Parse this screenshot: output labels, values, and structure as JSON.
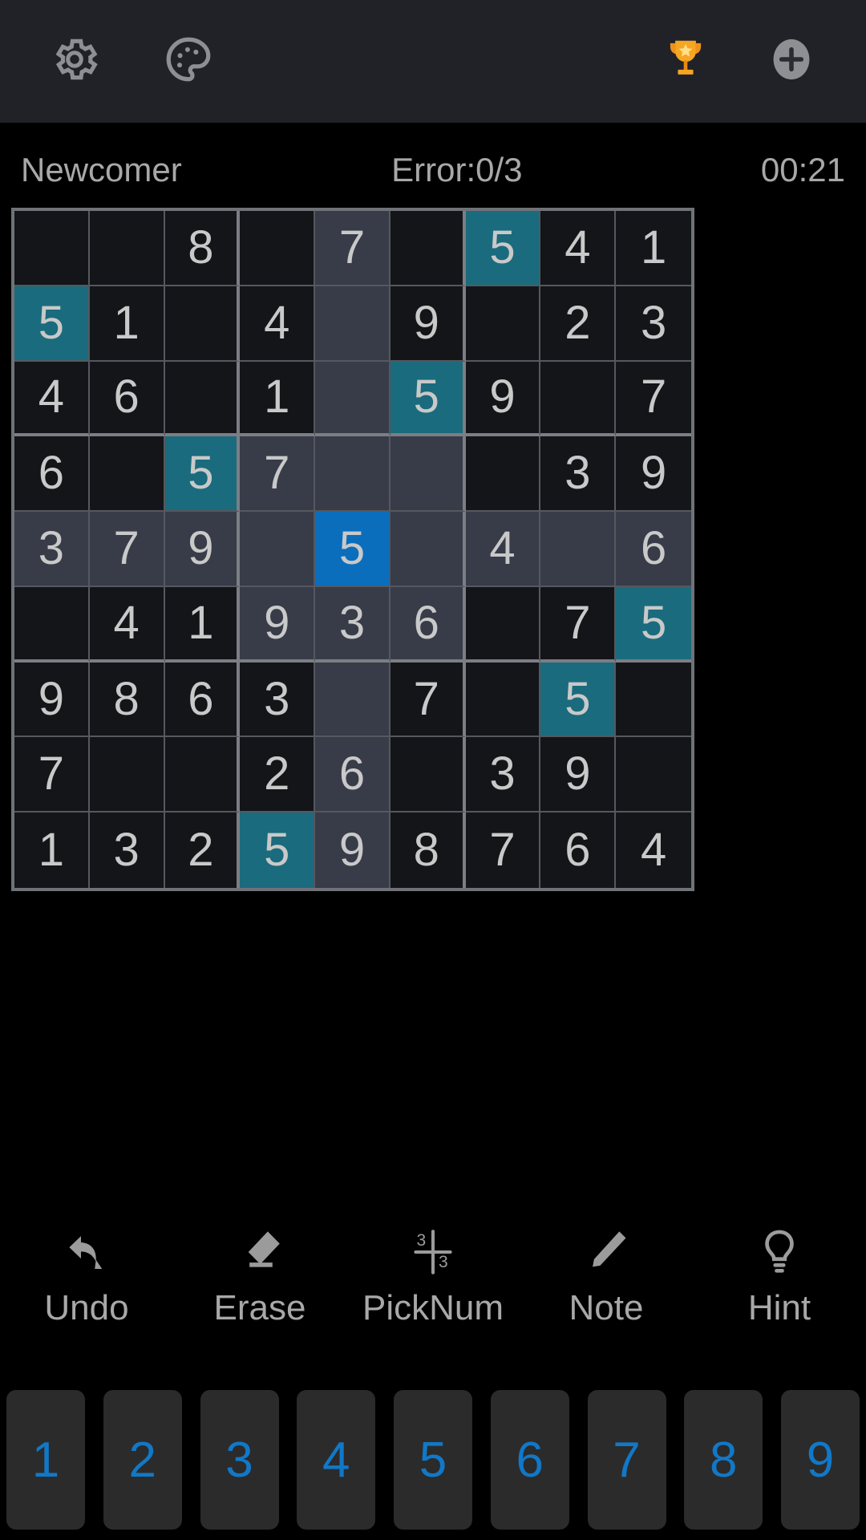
{
  "appbar": {
    "settings_icon": "gear-icon",
    "theme_icon": "palette-icon",
    "trophy_icon": "trophy-icon",
    "add_icon": "plus-circle-icon"
  },
  "status": {
    "difficulty": "Newcomer",
    "errors": "Error:0/3",
    "timer": "00:21"
  },
  "board": {
    "selected": {
      "row": 4,
      "col": 4
    },
    "highlight_value": "5",
    "colors": {
      "cell_bg": "#141519",
      "peer_bg": "#383c49",
      "same_value_bg": "#1a6b7d",
      "selected_bg": "#0a6ebd",
      "digit": "#c9c9c9",
      "grid_line": "#55585e",
      "box_line": "#7b7e84"
    },
    "rows": [
      [
        "",
        "",
        "8",
        "",
        "7",
        "",
        "5",
        "4",
        "1"
      ],
      [
        "5",
        "1",
        "",
        "4",
        "",
        "9",
        "",
        "2",
        "3"
      ],
      [
        "4",
        "6",
        "",
        "1",
        "",
        "5",
        "9",
        "",
        "7"
      ],
      [
        "6",
        "",
        "5",
        "7",
        "",
        "",
        "",
        "3",
        "9"
      ],
      [
        "3",
        "7",
        "9",
        "",
        "5",
        "",
        "4",
        "",
        "6"
      ],
      [
        "",
        "4",
        "1",
        "9",
        "3",
        "6",
        "",
        "7",
        "5"
      ],
      [
        "9",
        "8",
        "6",
        "3",
        "",
        "7",
        "",
        "5",
        ""
      ],
      [
        "7",
        "",
        "",
        "2",
        "6",
        "",
        "3",
        "9",
        ""
      ],
      [
        "1",
        "3",
        "2",
        "5",
        "9",
        "8",
        "7",
        "6",
        "4"
      ]
    ]
  },
  "tools": [
    {
      "label": "Undo",
      "icon": "undo-arrow-icon"
    },
    {
      "label": "Erase",
      "icon": "eraser-icon"
    },
    {
      "label": "PickNum",
      "icon": "picknum-icon"
    },
    {
      "label": "Note",
      "icon": "pencil-icon"
    },
    {
      "label": "Hint",
      "icon": "lightbulb-icon"
    }
  ],
  "numpad": {
    "keys": [
      "1",
      "2",
      "3",
      "4",
      "5",
      "6",
      "7",
      "8",
      "9"
    ],
    "color": "#1178c8"
  }
}
